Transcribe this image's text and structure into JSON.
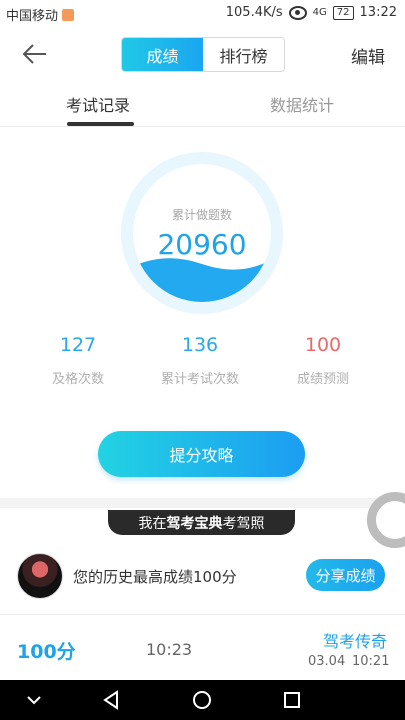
{
  "status_bar": {
    "carrier": "中国移动",
    "net_speed": "105.4K/s",
    "signal": "4G",
    "battery": "72",
    "time": "13:22"
  },
  "header": {
    "back_icon": "arrow-left-icon",
    "segments": [
      {
        "label": "成绩",
        "active": true
      },
      {
        "label": "排行榜",
        "active": false
      }
    ],
    "edit_label": "编辑"
  },
  "tabs": [
    {
      "label": "考试记录",
      "active": true
    },
    {
      "label": "数据统计",
      "active": false
    }
  ],
  "summary": {
    "circle_label": "累计做题数",
    "circle_value": "20960"
  },
  "stats": [
    {
      "value": "127",
      "label": "及格次数",
      "color": "#2aa7e6"
    },
    {
      "value": "136",
      "label": "累计考试次数",
      "color": "#2aa7e6"
    },
    {
      "value": "100",
      "label": "成绩预测",
      "color": "#e86a6a"
    }
  ],
  "cta_label": "提分攻略",
  "banner": {
    "prefix": "我在",
    "brand": "驾考宝典",
    "suffix": "考驾照"
  },
  "best": {
    "text": "您的历史最高成绩100分",
    "share_label": "分享成绩"
  },
  "record": {
    "score": "100分",
    "duration": "10:23",
    "title": "驾考传奇",
    "date": "03.04",
    "time": "10:21"
  },
  "colors": {
    "accent": "#1ea3e8",
    "danger": "#e86a6a"
  }
}
